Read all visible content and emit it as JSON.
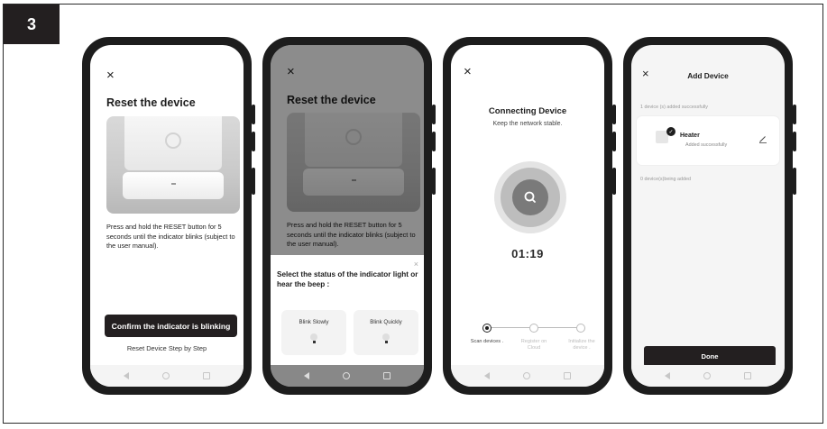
{
  "step_number": "3",
  "screen1": {
    "close_glyph": "×",
    "title": "Reset the device",
    "instructions": "Press and hold the RESET button for 5 seconds until the indicator blinks (subject to the user manual).",
    "confirm_button": "Confirm the indicator is blinking",
    "reset_link": "Reset Device Step by Step"
  },
  "screen2": {
    "close_glyph": "×",
    "title": "Reset the device",
    "instructions": "Press and hold the RESET button for 5 seconds until the indicator blinks (subject to the user manual).",
    "sheet_close_glyph": "×",
    "sheet_title": "Select the status of the indicator light or hear the beep :",
    "options": [
      "Blink Slowly",
      "Blink Quickly"
    ]
  },
  "screen3": {
    "close_glyph": "×",
    "title": "Connecting Device",
    "subtitle": "Keep the network stable.",
    "timer": "01:19",
    "steps": [
      {
        "label": "Scan devices .",
        "active": true
      },
      {
        "label": "Register on Cloud",
        "active": false
      },
      {
        "label": "Initialize the device .",
        "active": false
      }
    ]
  },
  "screen4": {
    "close_glyph": "×",
    "title": "Add Device",
    "added_summary": "1 device (s) added successfully",
    "device_name": "Heater",
    "device_status": "Added successfully",
    "being_added": "0 device(s)being added",
    "done_button": "Done"
  },
  "colors": {
    "button_dark": "#231f20",
    "frame_border": "#2a2a2a"
  },
  "icons": {
    "search": "magnifier-icon",
    "edit": "pencil-icon",
    "check": "check-icon"
  }
}
